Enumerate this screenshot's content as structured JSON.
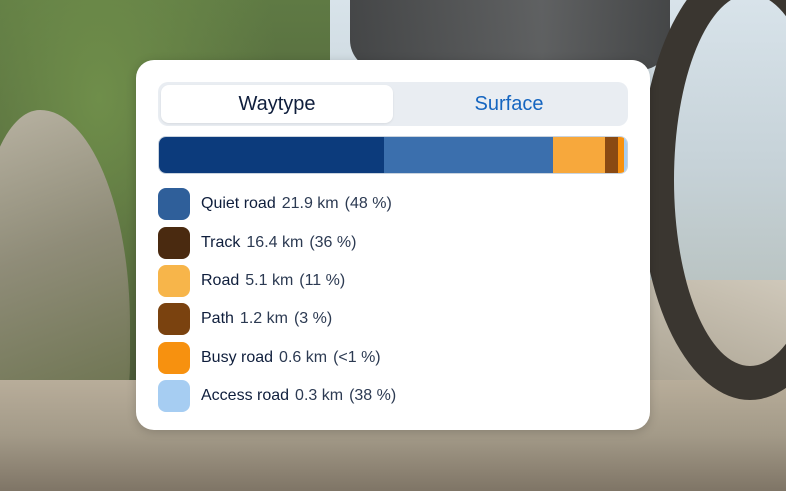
{
  "tabs": [
    {
      "label": "Waytype",
      "active": true
    },
    {
      "label": "Surface",
      "active": false
    }
  ],
  "colors": {
    "quiet_road": "#0c3b7c",
    "quiet_road_swatch": "#2f5f9a",
    "track": "#3b6fad",
    "track_swatch": "#4a2a10",
    "road": "#f7a83c",
    "path": "#8a4a12",
    "busy_road": "#f7910f",
    "access_road": "#a6cdf2"
  },
  "chart_data": {
    "type": "bar",
    "orientation": "stacked-horizontal",
    "categories": [
      "Quiet road",
      "Track",
      "Road",
      "Path",
      "Busy road",
      "Access road"
    ],
    "values": [
      21.9,
      16.4,
      5.1,
      1.2,
      0.6,
      0.3
    ],
    "unit": "km",
    "bar_colors": [
      "#0c3b7c",
      "#3b6fad",
      "#f7a83c",
      "#8a4a12",
      "#f7910f",
      "#a6cdf2"
    ],
    "swatch_colors": [
      "#2f5f9a",
      "#4a2a10",
      "#f7b54a",
      "#7a420f",
      "#f7910f",
      "#a6cdf2"
    ]
  },
  "legend": [
    {
      "name": "Quiet road",
      "value": "21.9 km",
      "pct": "(48 %)"
    },
    {
      "name": "Track",
      "value": "16.4 km",
      "pct": "(36 %)"
    },
    {
      "name": "Road",
      "value": "5.1 km",
      "pct": "(11 %)"
    },
    {
      "name": "Path",
      "value": "1.2 km",
      "pct": "(3 %)"
    },
    {
      "name": "Busy road",
      "value": "0.6 km",
      "pct": "(<1 %)"
    },
    {
      "name": "Access road",
      "value": "0.3 km",
      "pct": "(38 %)"
    }
  ]
}
